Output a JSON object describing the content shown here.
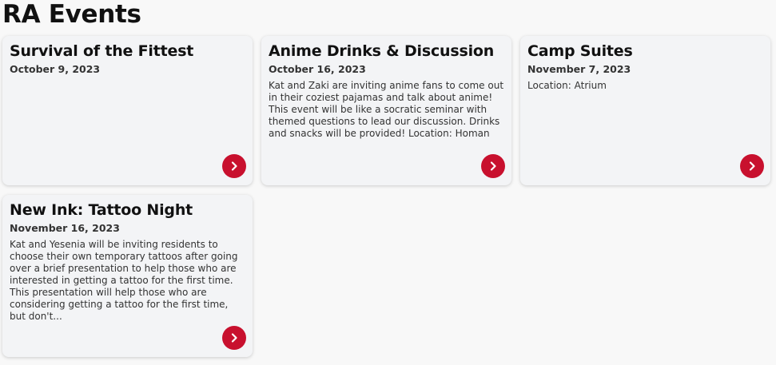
{
  "page": {
    "title": "RA Events"
  },
  "colors": {
    "accent": "#c8102e",
    "card_bg": "#f3f4f6",
    "page_bg": "#f8f8f8"
  },
  "events": [
    {
      "title": "Survival of the Fittest",
      "date": "October 9, 2023",
      "description": "",
      "button_icon": "chevron-right-icon"
    },
    {
      "title": "Anime Drinks & Discussion",
      "date": "October 16, 2023",
      "description": "Kat and Zaki are inviting anime fans to come out in their coziest pajamas and talk about anime! This event will be like a socratic seminar with themed questions to lead our discussion. Drinks and snacks will be provided! Location: Homan",
      "button_icon": "chevron-right-icon"
    },
    {
      "title": "Camp Suites",
      "date": "November 7, 2023",
      "description": "Location: Atrium",
      "button_icon": "chevron-right-icon"
    },
    {
      "title": "New Ink: Tattoo Night",
      "date": "November 16, 2023",
      "description": "Kat and Yesenia will be inviting residents to choose their own temporary tattoos after going over a brief presentation to help those who are interested in getting a tattoo for the first time. This presentation will help those who are considering getting a tattoo for the first time, but don't...",
      "button_icon": "chevron-right-icon"
    }
  ]
}
